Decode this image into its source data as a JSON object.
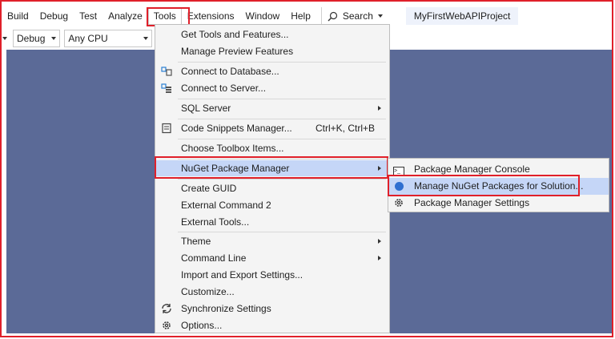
{
  "menubar": {
    "items": [
      {
        "label": "Build"
      },
      {
        "label": "Debug"
      },
      {
        "label": "Test"
      },
      {
        "label": "Analyze"
      },
      {
        "label": "Tools"
      },
      {
        "label": "Extensions"
      },
      {
        "label": "Window"
      },
      {
        "label": "Help"
      }
    ],
    "search_label": "Search",
    "project_name": "MyFirstWebAPIProject"
  },
  "toolbar": {
    "configuration": "Debug",
    "platform": "Any CPU"
  },
  "tools_menu": {
    "items": [
      {
        "label": "Get Tools and Features..."
      },
      {
        "label": "Manage Preview Features"
      },
      {
        "label": "Connect to Database..."
      },
      {
        "label": "Connect to Server..."
      },
      {
        "label": "SQL Server"
      },
      {
        "label": "Code Snippets Manager...",
        "shortcut": "Ctrl+K, Ctrl+B"
      },
      {
        "label": "Choose Toolbox Items..."
      },
      {
        "label": "NuGet Package Manager"
      },
      {
        "label": "Create GUID"
      },
      {
        "label": "External Command 2"
      },
      {
        "label": "External Tools..."
      },
      {
        "label": "Theme"
      },
      {
        "label": "Command Line"
      },
      {
        "label": "Import and Export Settings..."
      },
      {
        "label": "Customize..."
      },
      {
        "label": "Synchronize Settings"
      },
      {
        "label": "Options..."
      }
    ]
  },
  "nuget_submenu": {
    "items": [
      {
        "label": "Package Manager Console"
      },
      {
        "label": "Manage NuGet Packages for Solution..."
      },
      {
        "label": "Package Manager Settings"
      }
    ]
  },
  "colors": {
    "highlight_border": "#e0202a",
    "workspace": "#5b6a97",
    "menu_hover": "#c5d6f7"
  }
}
